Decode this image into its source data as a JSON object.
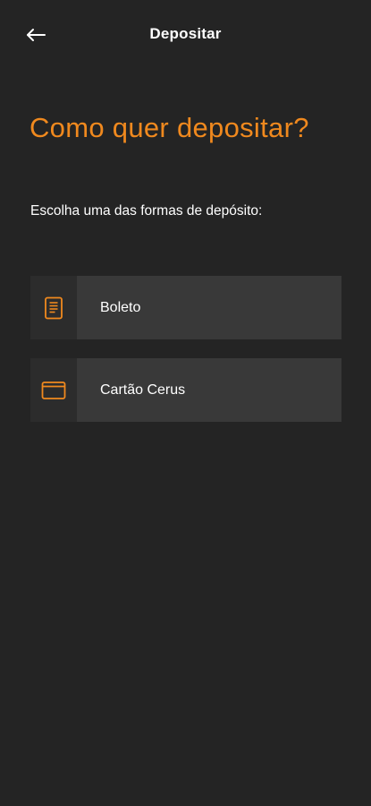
{
  "header": {
    "title": "Depositar",
    "back_icon": "arrow-left-icon"
  },
  "main": {
    "heading": "Como quer depositar?",
    "subtitle": "Escolha uma das formas de depósito:"
  },
  "options": [
    {
      "label": "Boleto",
      "icon": "document-icon"
    },
    {
      "label": "Cartão Cerus",
      "icon": "card-icon"
    }
  ],
  "colors": {
    "background": "#242424",
    "accent": "#f0891e",
    "option_background": "#393939",
    "option_icon_background": "#2c2c2c",
    "text": "#ffffff"
  }
}
